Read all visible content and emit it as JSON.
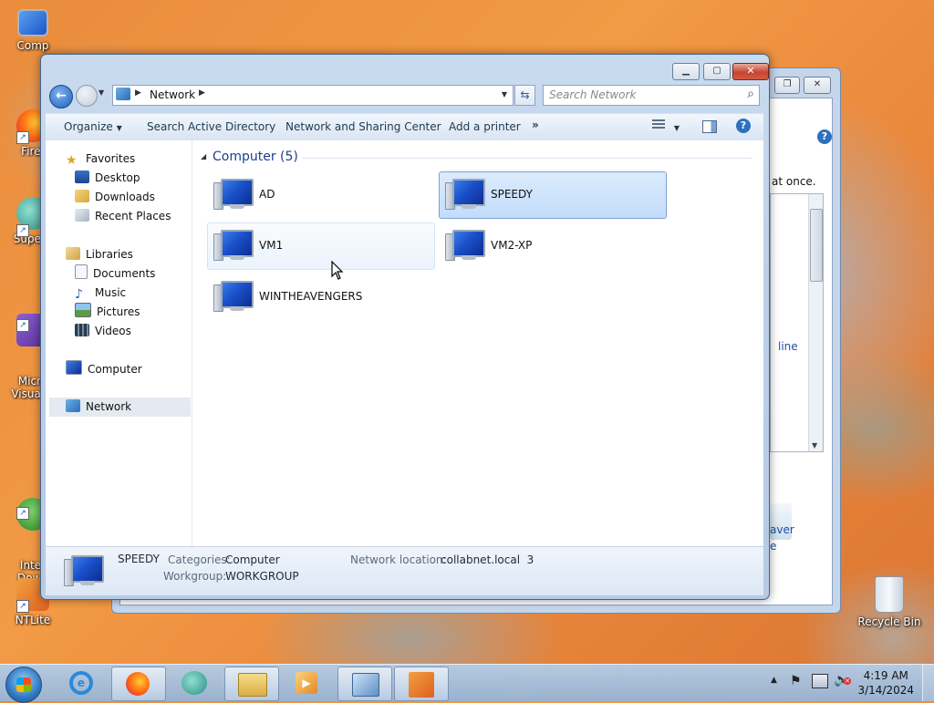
{
  "desktop": {
    "icons": [
      {
        "label": "Comp"
      },
      {
        "label": "Firef"
      },
      {
        "label": "Supern"
      },
      {
        "label": "Micro\nVisual S"
      },
      {
        "label": "Inter\nDown"
      },
      {
        "label": "NTLite"
      },
      {
        "label": "Recycle Bin"
      }
    ]
  },
  "background_window": {
    "text_fragments": [
      "at once.",
      "line",
      "aver",
      "e"
    ]
  },
  "explorer": {
    "address": {
      "root_label": "Network"
    },
    "search": {
      "placeholder": "Search Network"
    },
    "toolbar": {
      "organize": "Organize",
      "search_ad": "Search Active Directory",
      "network_sharing": "Network and Sharing Center",
      "add_printer": "Add a printer",
      "more": "»"
    },
    "nav": {
      "favorites": "Favorites",
      "desktop": "Desktop",
      "downloads": "Downloads",
      "recent": "Recent Places",
      "libraries": "Libraries",
      "documents": "Documents",
      "music": "Music",
      "pictures": "Pictures",
      "videos": "Videos",
      "computer": "Computer",
      "network": "Network"
    },
    "group": {
      "header": "Computer (5)"
    },
    "items": [
      {
        "name": "AD"
      },
      {
        "name": "SPEEDY"
      },
      {
        "name": "VM1"
      },
      {
        "name": "VM2-XP"
      },
      {
        "name": "WINTHEAVENGERS"
      }
    ],
    "details": {
      "name": "SPEEDY",
      "categories_label": "Categories:",
      "categories_value": "Computer",
      "workgroup_label": "Workgroup:",
      "workgroup_value": "WORKGROUP",
      "location_label": "Network location:",
      "location_value": "collabnet.local  3"
    }
  },
  "taskbar": {
    "clock_time": "4:19 AM",
    "clock_date": "3/14/2024"
  },
  "colors": {
    "selection": "#c1dcfb",
    "title_close": "#c74531",
    "link_blue": "#1e4ea6"
  }
}
